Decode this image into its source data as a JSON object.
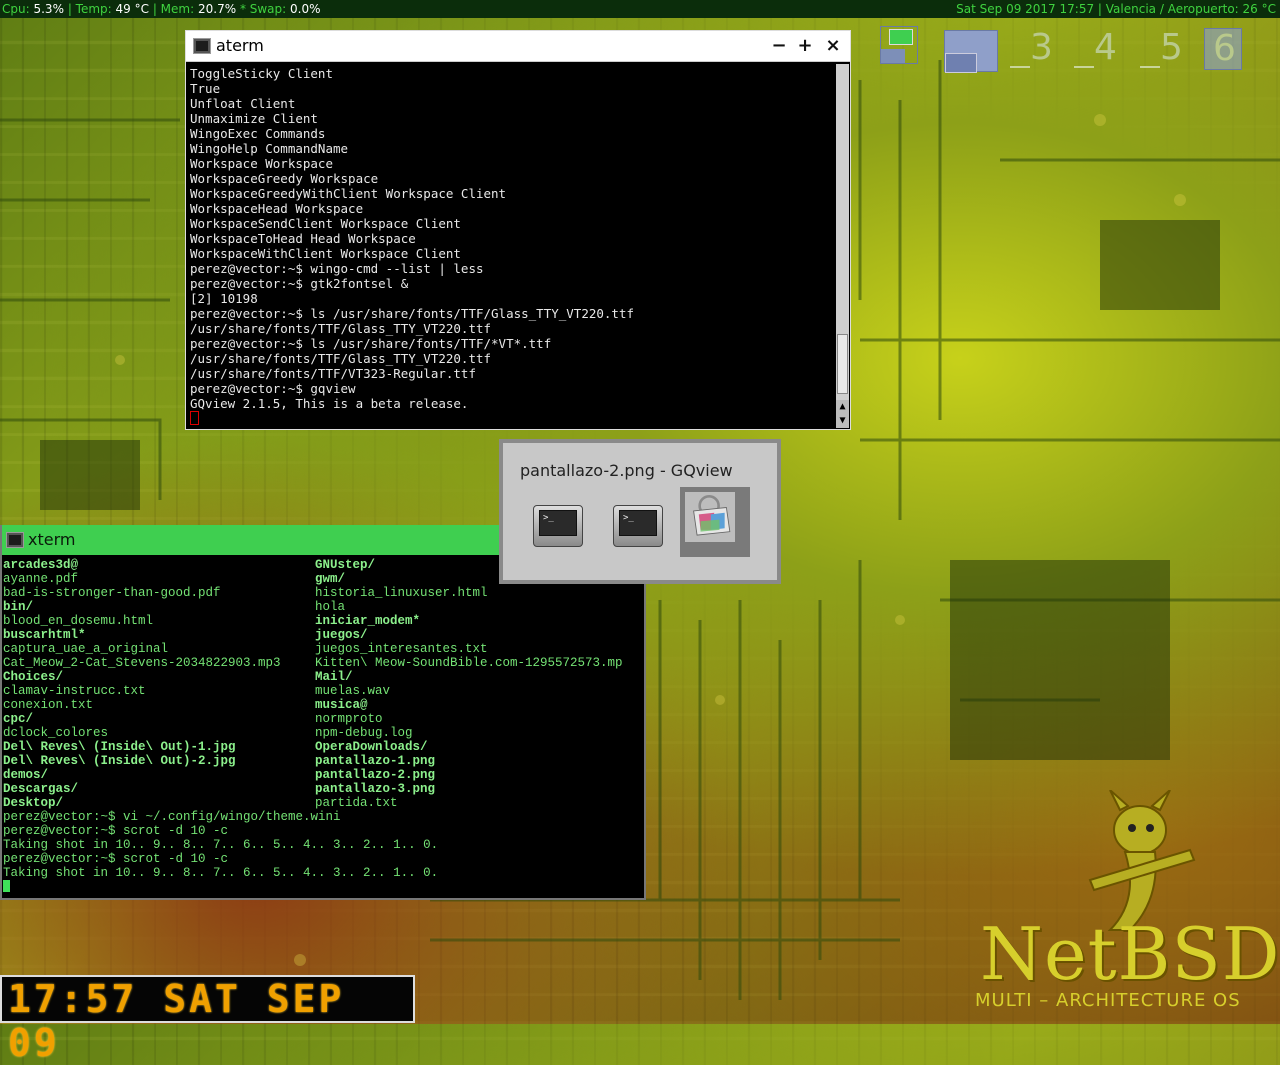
{
  "topbar": {
    "cpu_label": "Cpu:",
    "cpu_value": "5.3%",
    "temp_label": "| Temp:",
    "temp_value": "49 °C",
    "mem_label": "| Mem:",
    "mem_value": "20.7%",
    "swap_label": "* Swap:",
    "swap_value": "0.0%",
    "datetime": "Sat Sep 09 2017 17:57",
    "weather": "| Valencia / Aeropuerto: 26 °C"
  },
  "pager": {
    "workspaces": [
      "3",
      "4",
      "5",
      "6"
    ]
  },
  "aterm": {
    "title": "aterm",
    "btn_min": "−",
    "btn_max": "+",
    "btn_close": "×",
    "lines": [
      "ToggleSticky Client",
      "True",
      "Unfloat Client",
      "Unmaximize Client",
      "WingoExec Commands",
      "WingoHelp CommandName",
      "Workspace Workspace",
      "WorkspaceGreedy Workspace",
      "WorkspaceGreedyWithClient Workspace Client",
      "WorkspaceHead Workspace",
      "WorkspaceSendClient Workspace Client",
      "WorkspaceToHead Head Workspace",
      "WorkspaceWithClient Workspace Client",
      "perez@vector:~$ wingo-cmd --list | less",
      "perez@vector:~$ gtk2fontsel &",
      "[2] 10198",
      "perez@vector:~$ ls /usr/share/fonts/TTF/Glass_TTY_VT220.ttf",
      "/usr/share/fonts/TTF/Glass_TTY_VT220.ttf",
      "perez@vector:~$ ls /usr/share/fonts/TTF/*VT*.ttf",
      "/usr/share/fonts/TTF/Glass_TTY_VT220.ttf",
      "/usr/share/fonts/TTF/VT323-Regular.ttf",
      "perez@vector:~$ gqview",
      "GQview 2.1.5, This is a beta release."
    ]
  },
  "xterm": {
    "title": "xterm",
    "col1": [
      {
        "t": "arcades3d@",
        "b": true
      },
      {
        "t": "ayanne.pdf",
        "b": false
      },
      {
        "t": "bad-is-stronger-than-good.pdf",
        "b": false
      },
      {
        "t": "bin/",
        "b": true
      },
      {
        "t": "blood_en_dosemu.html",
        "b": false
      },
      {
        "t": "buscarhtml*",
        "b": true
      },
      {
        "t": "captura_uae_a_original",
        "b": false
      },
      {
        "t": "Cat_Meow_2-Cat_Stevens-2034822903.mp3",
        "b": false
      },
      {
        "t": "Choices/",
        "b": true
      },
      {
        "t": "clamav-instrucc.txt",
        "b": false
      },
      {
        "t": "conexion.txt",
        "b": false
      },
      {
        "t": "cpc/",
        "b": true
      },
      {
        "t": "dclock_colores",
        "b": false
      },
      {
        "t": "Del\\ Reves\\ (Inside\\ Out)-1.jpg",
        "b": true
      },
      {
        "t": "Del\\ Reves\\ (Inside\\ Out)-2.jpg",
        "b": true
      },
      {
        "t": "demos/",
        "b": true
      },
      {
        "t": "Descargas/",
        "b": true
      },
      {
        "t": "Desktop/",
        "b": true
      }
    ],
    "col2": [
      {
        "t": "GNUstep/",
        "b": true
      },
      {
        "t": "gwm/",
        "b": true
      },
      {
        "t": "historia_linuxuser.html",
        "b": false
      },
      {
        "t": "hola",
        "b": false
      },
      {
        "t": "iniciar_modem*",
        "b": true
      },
      {
        "t": "juegos/",
        "b": true
      },
      {
        "t": "juegos_interesantes.txt",
        "b": false
      },
      {
        "t": "Kitten\\ Meow-SoundBible.com-1295572573.mp",
        "b": false
      },
      {
        "t": "Mail/",
        "b": true
      },
      {
        "t": "muelas.wav",
        "b": false
      },
      {
        "t": "musica@",
        "b": true
      },
      {
        "t": "normproto",
        "b": false
      },
      {
        "t": "npm-debug.log",
        "b": false
      },
      {
        "t": "OperaDownloads/",
        "b": true
      },
      {
        "t": "pantallazo-1.png",
        "b": true
      },
      {
        "t": "pantallazo-2.png",
        "b": true
      },
      {
        "t": "pantallazo-3.png",
        "b": true
      },
      {
        "t": "partida.txt",
        "b": false
      }
    ],
    "cmd_lines": [
      "perez@vector:~$ vi ~/.config/wingo/theme.wini",
      "perez@vector:~$ scrot -d 10 -c",
      "Taking shot in 10.. 9.. 8.. 7.. 6.. 5.. 4.. 3.. 2.. 1.. 0.",
      "perez@vector:~$ scrot -d 10 -c",
      "Taking shot in 10.. 9.. 8.. 7.. 6.. 5.. 4.. 3.. 2.. 1.. 0."
    ]
  },
  "switcher": {
    "title": "pantallazo-2.png - GQview",
    "items": [
      "terminal-icon",
      "terminal-icon",
      "image-viewer-icon"
    ],
    "prompt_glyph": ">_"
  },
  "clock": {
    "text": "17:57 SAT SEP 09"
  },
  "logo": {
    "word": "NetBSD",
    "sub": "MULTI – ARCHITECTURE  OS"
  },
  "colors": {
    "bar_bg": "#0b2d0b",
    "bar_fg": "#3fd23f",
    "xterm_title": "#3fcf50",
    "term_green": "#74e274",
    "clock_amber": "#f0a000"
  }
}
